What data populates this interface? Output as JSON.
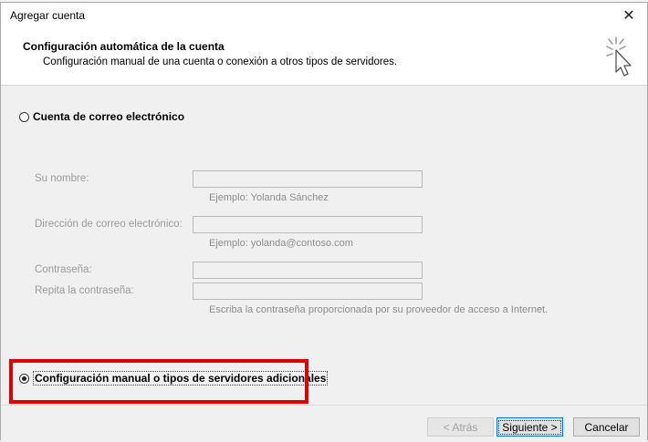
{
  "window": {
    "title": "Agregar cuenta",
    "close_symbol": "✕"
  },
  "header": {
    "title": "Configuración automática de la cuenta",
    "subtitle": "Configuración manual de una cuenta o conexión a otros tipos de servidores.",
    "icon": "wizard-cursor-icon"
  },
  "options": {
    "email_account_label": "Cuenta de correo electrónico",
    "email_account_selected": false,
    "manual_setup_label": "Configuración manual o tipos de servidores adicionales",
    "manual_setup_selected": true
  },
  "form": {
    "name_label": "Su nombre:",
    "name_value": "",
    "name_hint": "Ejemplo: Yolanda Sánchez",
    "email_label": "Dirección de correo electrónico:",
    "email_value": "",
    "email_hint": "Ejemplo: yolanda@contoso.com",
    "password_label": "Contraseña:",
    "password_value": "",
    "repeat_password_label": "Repita la contraseña:",
    "repeat_password_value": "",
    "password_hint": "Escriba la contraseña proporcionada por su proveedor de acceso a Internet."
  },
  "footer": {
    "back_label": "< Atrás",
    "next_label": "Siguiente >",
    "cancel_label": "Cancelar"
  },
  "colors": {
    "highlight": "#e00000",
    "default_button_border": "#0078d7"
  }
}
